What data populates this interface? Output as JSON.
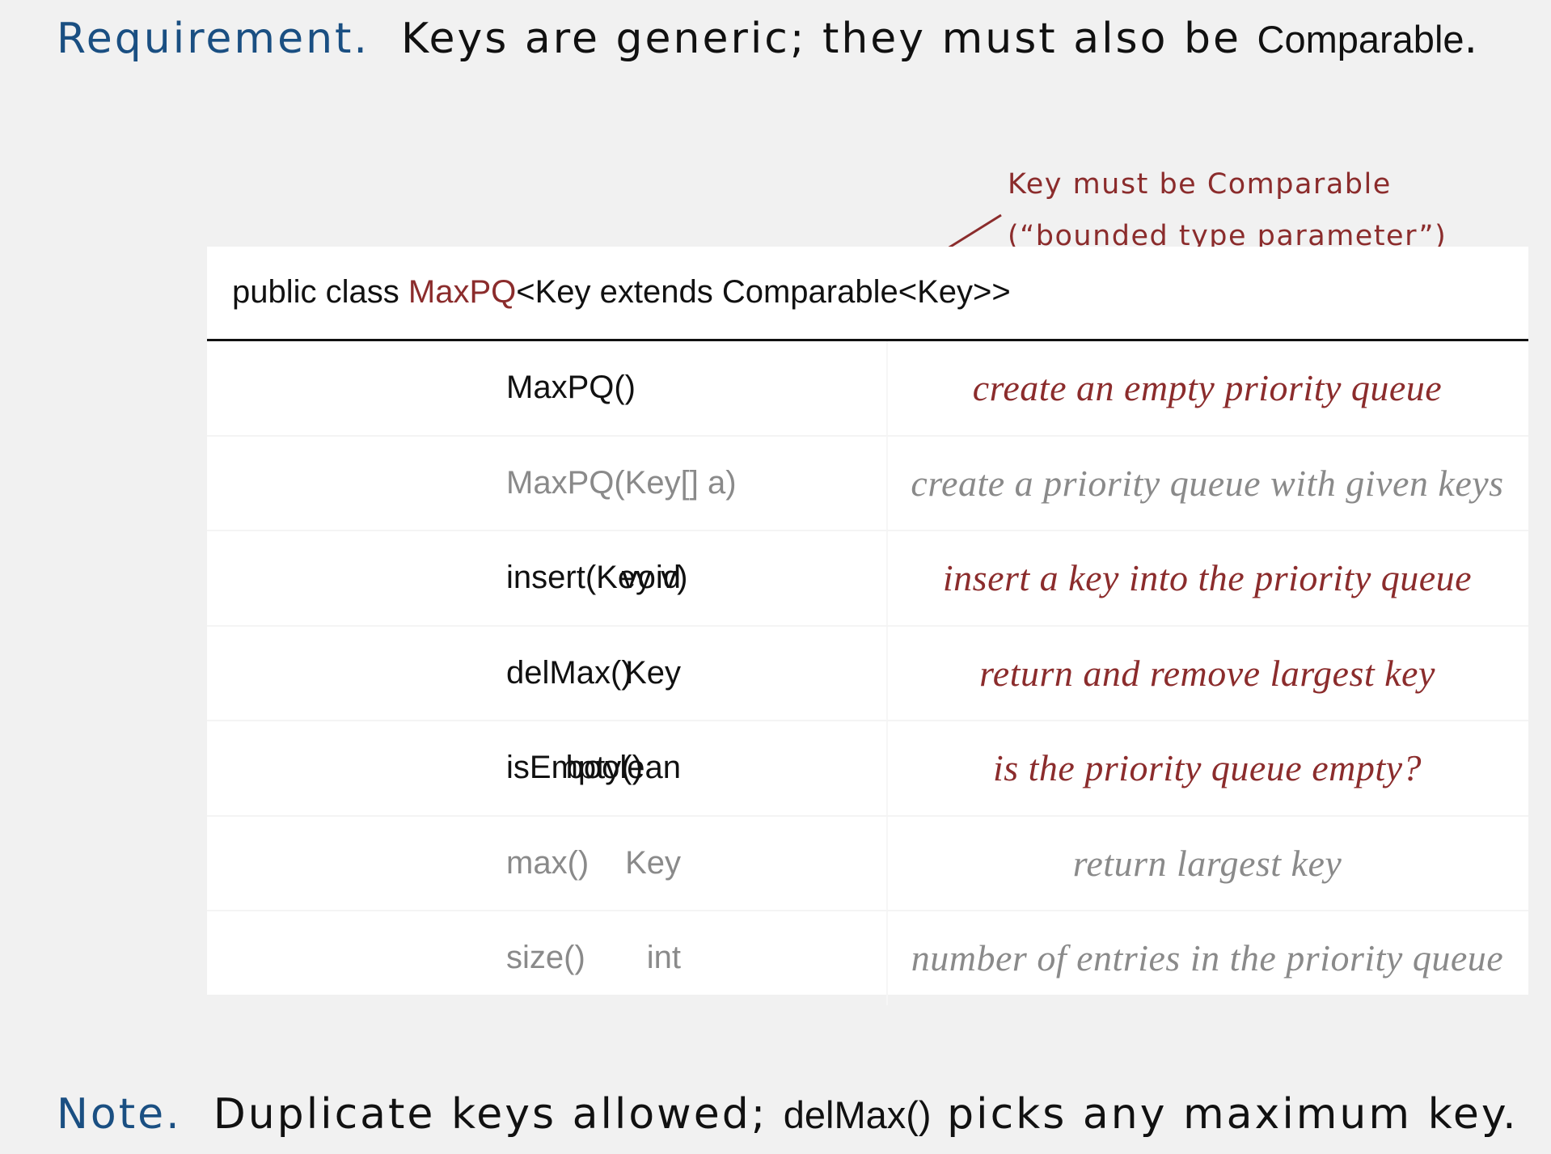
{
  "requirement": {
    "label": "Requirement.",
    "text": "Keys are generic; they must also be",
    "code": "Comparable",
    "end": "."
  },
  "annotation": {
    "line1": "Key must be Comparable",
    "line2": "(“bounded type parameter”)"
  },
  "api": {
    "signature_prefix": "public class ",
    "class_name": "MaxPQ",
    "signature_suffix": "<Key extends Comparable<Key>>",
    "rows": [
      {
        "type": "",
        "method": "MaxPQ()",
        "desc": "create an empty priority queue",
        "style": "dark"
      },
      {
        "type": "",
        "method": "MaxPQ(Key[] a)",
        "desc": "create a priority queue with given keys",
        "style": "gray"
      },
      {
        "type": "void",
        "method": "insert(Key v)",
        "desc": "insert a key into the priority queue",
        "style": "dark"
      },
      {
        "type": "Key",
        "method": "delMax()",
        "desc": "return and remove largest key",
        "style": "dark"
      },
      {
        "type": "boolean",
        "method": "isEmpty()",
        "desc": "is the priority queue empty?",
        "style": "dark"
      },
      {
        "type": "Key",
        "method": "max()",
        "desc": "return largest key",
        "style": "gray"
      },
      {
        "type": "int",
        "method": "size()",
        "desc": "number of entries in the priority queue",
        "style": "gray"
      }
    ]
  },
  "note": {
    "label": "Note.",
    "text1": "Duplicate keys allowed;",
    "code": "delMax()",
    "text2": "picks any maximum key."
  }
}
